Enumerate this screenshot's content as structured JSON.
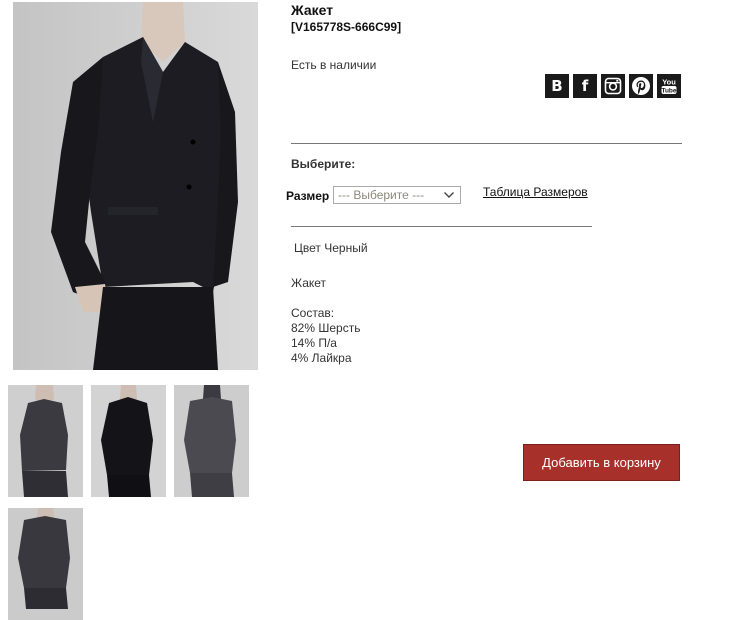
{
  "product": {
    "title": "Жакет",
    "sku": "[V165778S-666C99]",
    "availability": "Есть в наличии",
    "choose_label": "Выберите:",
    "size_label": "Размер",
    "size_select_value": "--- Выберите ---",
    "size_table_link": "Таблица Размеров",
    "color": "Цвет Черный",
    "description": "Жакет",
    "composition_heading": "Состав:",
    "composition": [
      "82% Шерсть",
      "14% П/а",
      "4% Лайкра"
    ],
    "add_to_cart": "Добавить в корзину"
  },
  "social": [
    {
      "icon": "vk-icon",
      "glyph": "B"
    },
    {
      "icon": "facebook-icon",
      "glyph": "f"
    },
    {
      "icon": "instagram-icon",
      "glyph": ""
    },
    {
      "icon": "pinterest-icon",
      "glyph": ""
    },
    {
      "icon": "youtube-icon",
      "glyph": ""
    }
  ],
  "colors": {
    "cart_button": "#a8302b",
    "social_bg": "#1a1a1a",
    "divider": "#777777"
  }
}
